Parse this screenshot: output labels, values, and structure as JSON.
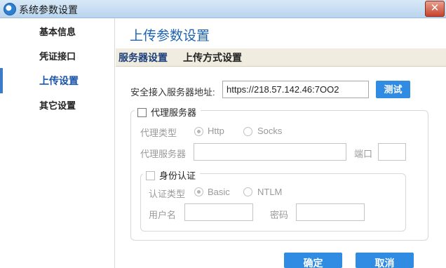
{
  "window": {
    "title": "系统参数设置",
    "close_glyph": "✕"
  },
  "sidebar": {
    "items": [
      {
        "label": "基本信息"
      },
      {
        "label": "凭证接口"
      },
      {
        "label": "上传设置",
        "active": true
      },
      {
        "label": "其它设置"
      }
    ]
  },
  "main": {
    "title": "上传参数设置",
    "tabs": [
      {
        "label": "服务器设置",
        "active": true
      },
      {
        "label": "上传方式设置"
      }
    ],
    "server": {
      "label": "安全接入服务器地址:",
      "value": "https://218.57.142.46:7OO2",
      "test_button": "测试"
    },
    "proxy": {
      "checkbox_label": "代理服务器",
      "checked": false,
      "type_label": "代理类型",
      "type_options": [
        "Http",
        "Socks"
      ],
      "type_selected": "Http",
      "server_label": "代理服务器",
      "server_value": "",
      "port_label": "端口",
      "port_value": "",
      "auth": {
        "checkbox_label": "身份认证",
        "checked": false,
        "type_label": "认证类型",
        "type_options": [
          "Basic",
          "NTLM"
        ],
        "type_selected": "Basic",
        "username_label": "用户名",
        "username_value": "",
        "password_label": "密码",
        "password_value": ""
      }
    }
  },
  "footer": {
    "ok_label": "确定",
    "cancel_label": "取消"
  },
  "colors": {
    "accent": "#2f8ce2",
    "title_blue": "#1d63b3",
    "tabbar_bg": "#f1ece0",
    "active_side": "#1a55a8"
  }
}
